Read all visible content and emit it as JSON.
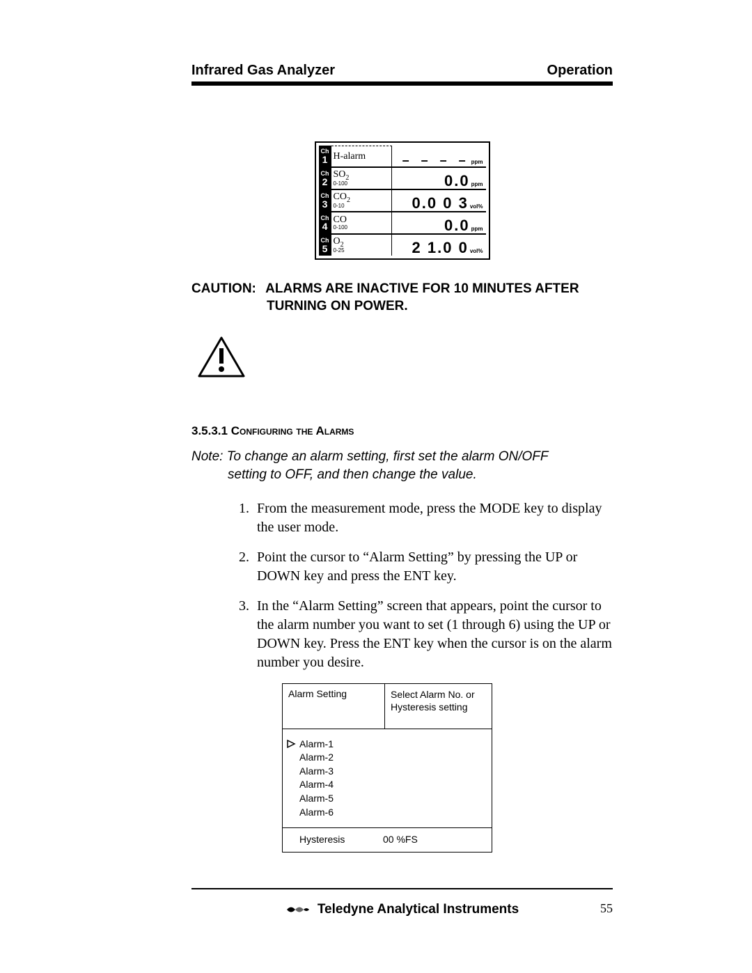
{
  "header": {
    "left": "Infrared Gas Analyzer",
    "right": "Operation"
  },
  "lcd": {
    "rows": [
      {
        "ch": "1",
        "gas": "H-alarm",
        "range": "",
        "value": "– – – –",
        "unit": "ppm",
        "special": true
      },
      {
        "ch": "2",
        "gas": "SO",
        "sub": "2",
        "range": "0-100",
        "value": "0.0",
        "unit": "ppm"
      },
      {
        "ch": "3",
        "gas": "CO",
        "sub": "2",
        "range": "0-10",
        "value": "0.0 0 3",
        "unit": "vol%"
      },
      {
        "ch": "4",
        "gas": "CO",
        "sub": "",
        "range": "0-100",
        "value": "0.0",
        "unit": "ppm"
      },
      {
        "ch": "5",
        "gas": "O",
        "sub": "2",
        "range": "0-25",
        "value": "2 1.0 0",
        "unit": "vol%"
      }
    ]
  },
  "caution": {
    "label": "CAUTION:",
    "body_a": "ALARMS ARE INACTIVE FOR 10 MINUTES AFTER",
    "body_b": "TURNING ON POWER."
  },
  "section": {
    "num": "3.5.3.1",
    "title": "Configuring the Alarms"
  },
  "note": {
    "line1": "Note:  To change an alarm setting, first set the alarm ON/OFF",
    "line2": "setting to OFF, and then change the value."
  },
  "steps": [
    "From the measurement mode, press the MODE key to display the user mode.",
    "Point the cursor to “Alarm Setting” by pressing the UP or DOWN key and press the ENT key.",
    "In the “Alarm Setting” screen that appears, point the cursor to the alarm number you want to set (1 through 6) using the UP or DOWN key. Press the ENT key when the cursor is on the alarm number you desire."
  ],
  "alarm_screen": {
    "title": "Alarm Setting",
    "hint1": "Select Alarm No. or",
    "hint2": "Hysteresis setting",
    "items": [
      "Alarm-1",
      "Alarm-2",
      "Alarm-3",
      "Alarm-4",
      "Alarm-5",
      "Alarm-6"
    ],
    "selected_index": 0,
    "hyst_label": "Hysteresis",
    "hyst_value": "00 %FS"
  },
  "footer": {
    "brand": "Teledyne Analytical Instruments",
    "page": "55"
  }
}
